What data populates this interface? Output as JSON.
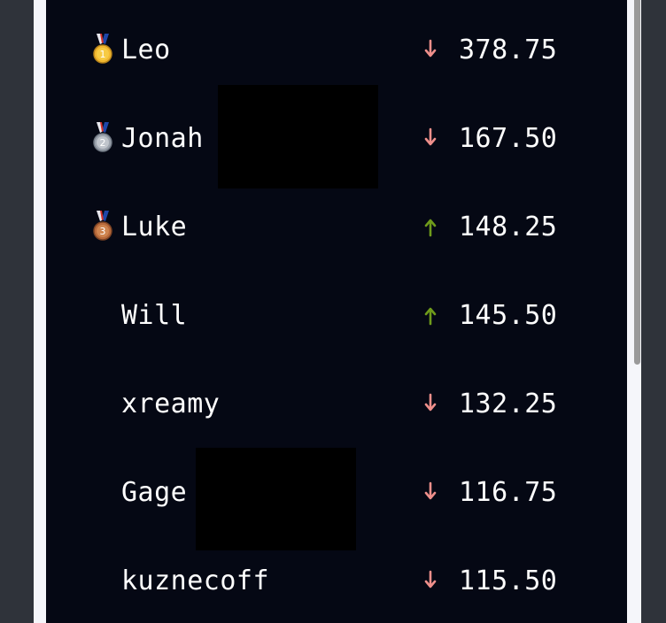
{
  "leaderboard": {
    "rows": [
      {
        "name": "Leo",
        "score": "378.75",
        "medal": "gold",
        "trend": "down"
      },
      {
        "name": "Jonah",
        "score": "167.50",
        "medal": "silver",
        "trend": "down"
      },
      {
        "name": "Luke",
        "score": "148.25",
        "medal": "bronze",
        "trend": "up"
      },
      {
        "name": "Will",
        "score": "145.50",
        "medal": "none",
        "trend": "up"
      },
      {
        "name": "xreamy",
        "score": "132.25",
        "medal": "none",
        "trend": "down"
      },
      {
        "name": "Gage",
        "score": "116.75",
        "medal": "none",
        "trend": "down"
      },
      {
        "name": "kuznecoff",
        "score": "115.50",
        "medal": "none",
        "trend": "down"
      }
    ],
    "medals": {
      "gold": {
        "label": "1",
        "color": "#f2b82f"
      },
      "silver": {
        "label": "2",
        "color": "#9ca3ad"
      },
      "bronze": {
        "label": "3",
        "color": "#b86a3b"
      }
    },
    "trend_colors": {
      "up": "#6f9b1b",
      "down": "#ef8f8b"
    },
    "icons": {
      "up": "arrow-up-icon",
      "down": "arrow-down-icon",
      "medal": "medal-icon"
    }
  }
}
